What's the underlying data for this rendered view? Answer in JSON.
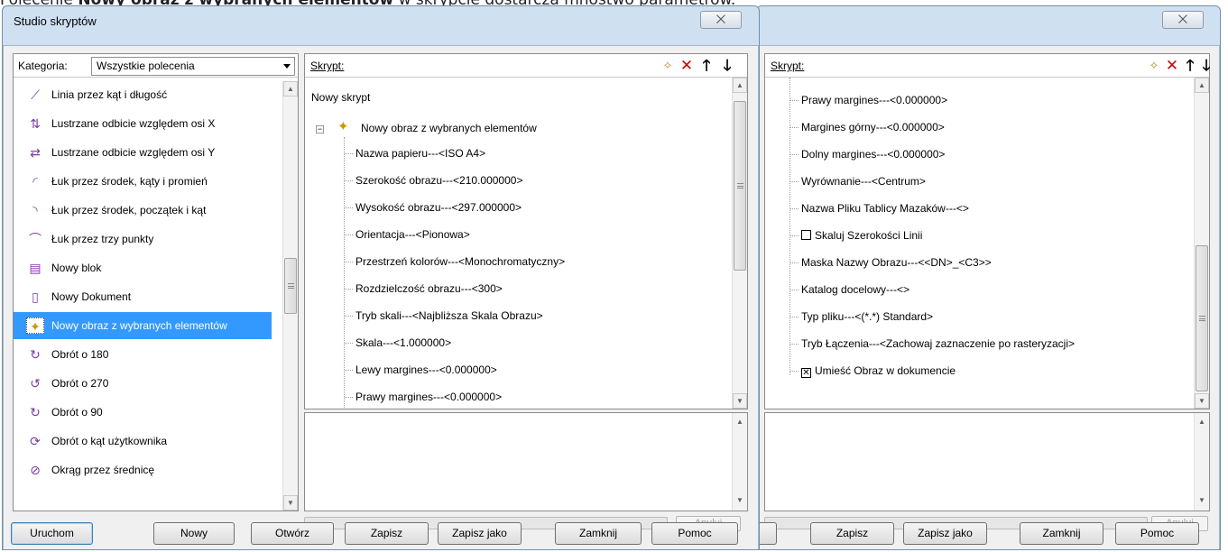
{
  "caption": {
    "prefix": "Polecenie ",
    "bold": "Nowy obraz z wybranych elementów",
    "suffix": " w skrypcie dostarcza mnóstwo parametrów."
  },
  "window": {
    "title": "Studio skryptów",
    "close_label": "⨉"
  },
  "category": {
    "label": "Kategoria:",
    "value": "Wszystkie polecenia"
  },
  "commands": [
    {
      "label": "Linia przez kąt i długość",
      "icon": "line-angle-icon",
      "glyph": "⟋"
    },
    {
      "label": "Lustrzane odbicie względem osi X",
      "icon": "mirror-x-icon",
      "glyph": "⇅"
    },
    {
      "label": "Lustrzane odbicie względem osi Y",
      "icon": "mirror-y-icon",
      "glyph": "⇄"
    },
    {
      "label": "Łuk przez środek, kąty i promień",
      "icon": "arc-center-angles-icon",
      "glyph": "◜"
    },
    {
      "label": "Łuk przez środek, początek i kąt",
      "icon": "arc-center-start-icon",
      "glyph": "◝"
    },
    {
      "label": "Łuk przez trzy punkty",
      "icon": "arc-three-points-icon",
      "glyph": "⌒"
    },
    {
      "label": "Nowy blok",
      "icon": "new-block-icon",
      "glyph": "▤"
    },
    {
      "label": "Nowy Dokument",
      "icon": "new-document-icon",
      "glyph": "▯"
    },
    {
      "label": "Nowy obraz z wybranych elementów",
      "icon": "new-image-icon",
      "glyph": "✦",
      "selected": true
    },
    {
      "label": "Obrót o 180",
      "icon": "rotate-180-icon",
      "glyph": "↻"
    },
    {
      "label": "Obrót o 270",
      "icon": "rotate-270-icon",
      "glyph": "↺"
    },
    {
      "label": "Obrót o 90",
      "icon": "rotate-90-icon",
      "glyph": "↻"
    },
    {
      "label": "Obrót o kąt użytkownika",
      "icon": "rotate-user-angle-icon",
      "glyph": "⟳"
    },
    {
      "label": "Okrąg przez średnicę",
      "icon": "circle-diameter-icon",
      "glyph": "⊘"
    }
  ],
  "script_label": "Skrypt:",
  "script_root": "Nowy skrypt",
  "script_command": "Nowy obraz z wybranych elementów",
  "params_left": [
    "Nazwa papieru---<ISO A4>",
    "Szerokość obrazu---<210.000000>",
    "Wysokość obrazu---<297.000000>",
    "Orientacja---<Pionowa>",
    "Przestrzeń kolorów---<Monochromatyczny>",
    "Rozdzielczość obrazu---<300>",
    "Tryb skali---<Najbliższa Skala Obrazu>",
    "Skala---<1.000000>",
    "Lewy margines---<0.000000>",
    "Prawy margines---<0.000000>"
  ],
  "params_right": [
    {
      "text": "Prawy margines---<0.000000>"
    },
    {
      "text": "Margines górny---<0.000000>"
    },
    {
      "text": "Dolny margines---<0.000000>"
    },
    {
      "text": "Wyrównanie---<Centrum>"
    },
    {
      "text": "Nazwa Pliku Tablicy Mazaków---<>"
    },
    {
      "text": "Skaluj Szerokości Linii",
      "checkbox": true,
      "checked": false
    },
    {
      "text": "Maska Nazwy Obrazu---<<DN>_<C3>>"
    },
    {
      "text": "Katalog docelowy---<>"
    },
    {
      "text": "Typ pliku---<(*.*) Standard>"
    },
    {
      "text": "Tryb Łączenia---<Zachowaj zaznaczenie po rasteryzacji>"
    },
    {
      "text": "Umieść Obraz w dokumencie",
      "checkbox": true,
      "checked": true
    }
  ],
  "cancel_label": "Anuluj",
  "buttons_left": {
    "run": "Uruchom",
    "new": "Nowy",
    "open": "Otwórz",
    "save": "Zapisz",
    "save_as": "Zapisz jako",
    "close": "Zamknij",
    "help": "Pomoc"
  },
  "buttons_right": {
    "open_partial": "órz",
    "save": "Zapisz",
    "save_as": "Zapisz jako",
    "close": "Zamknij",
    "help": "Pomoc"
  },
  "check_mark": "✕"
}
